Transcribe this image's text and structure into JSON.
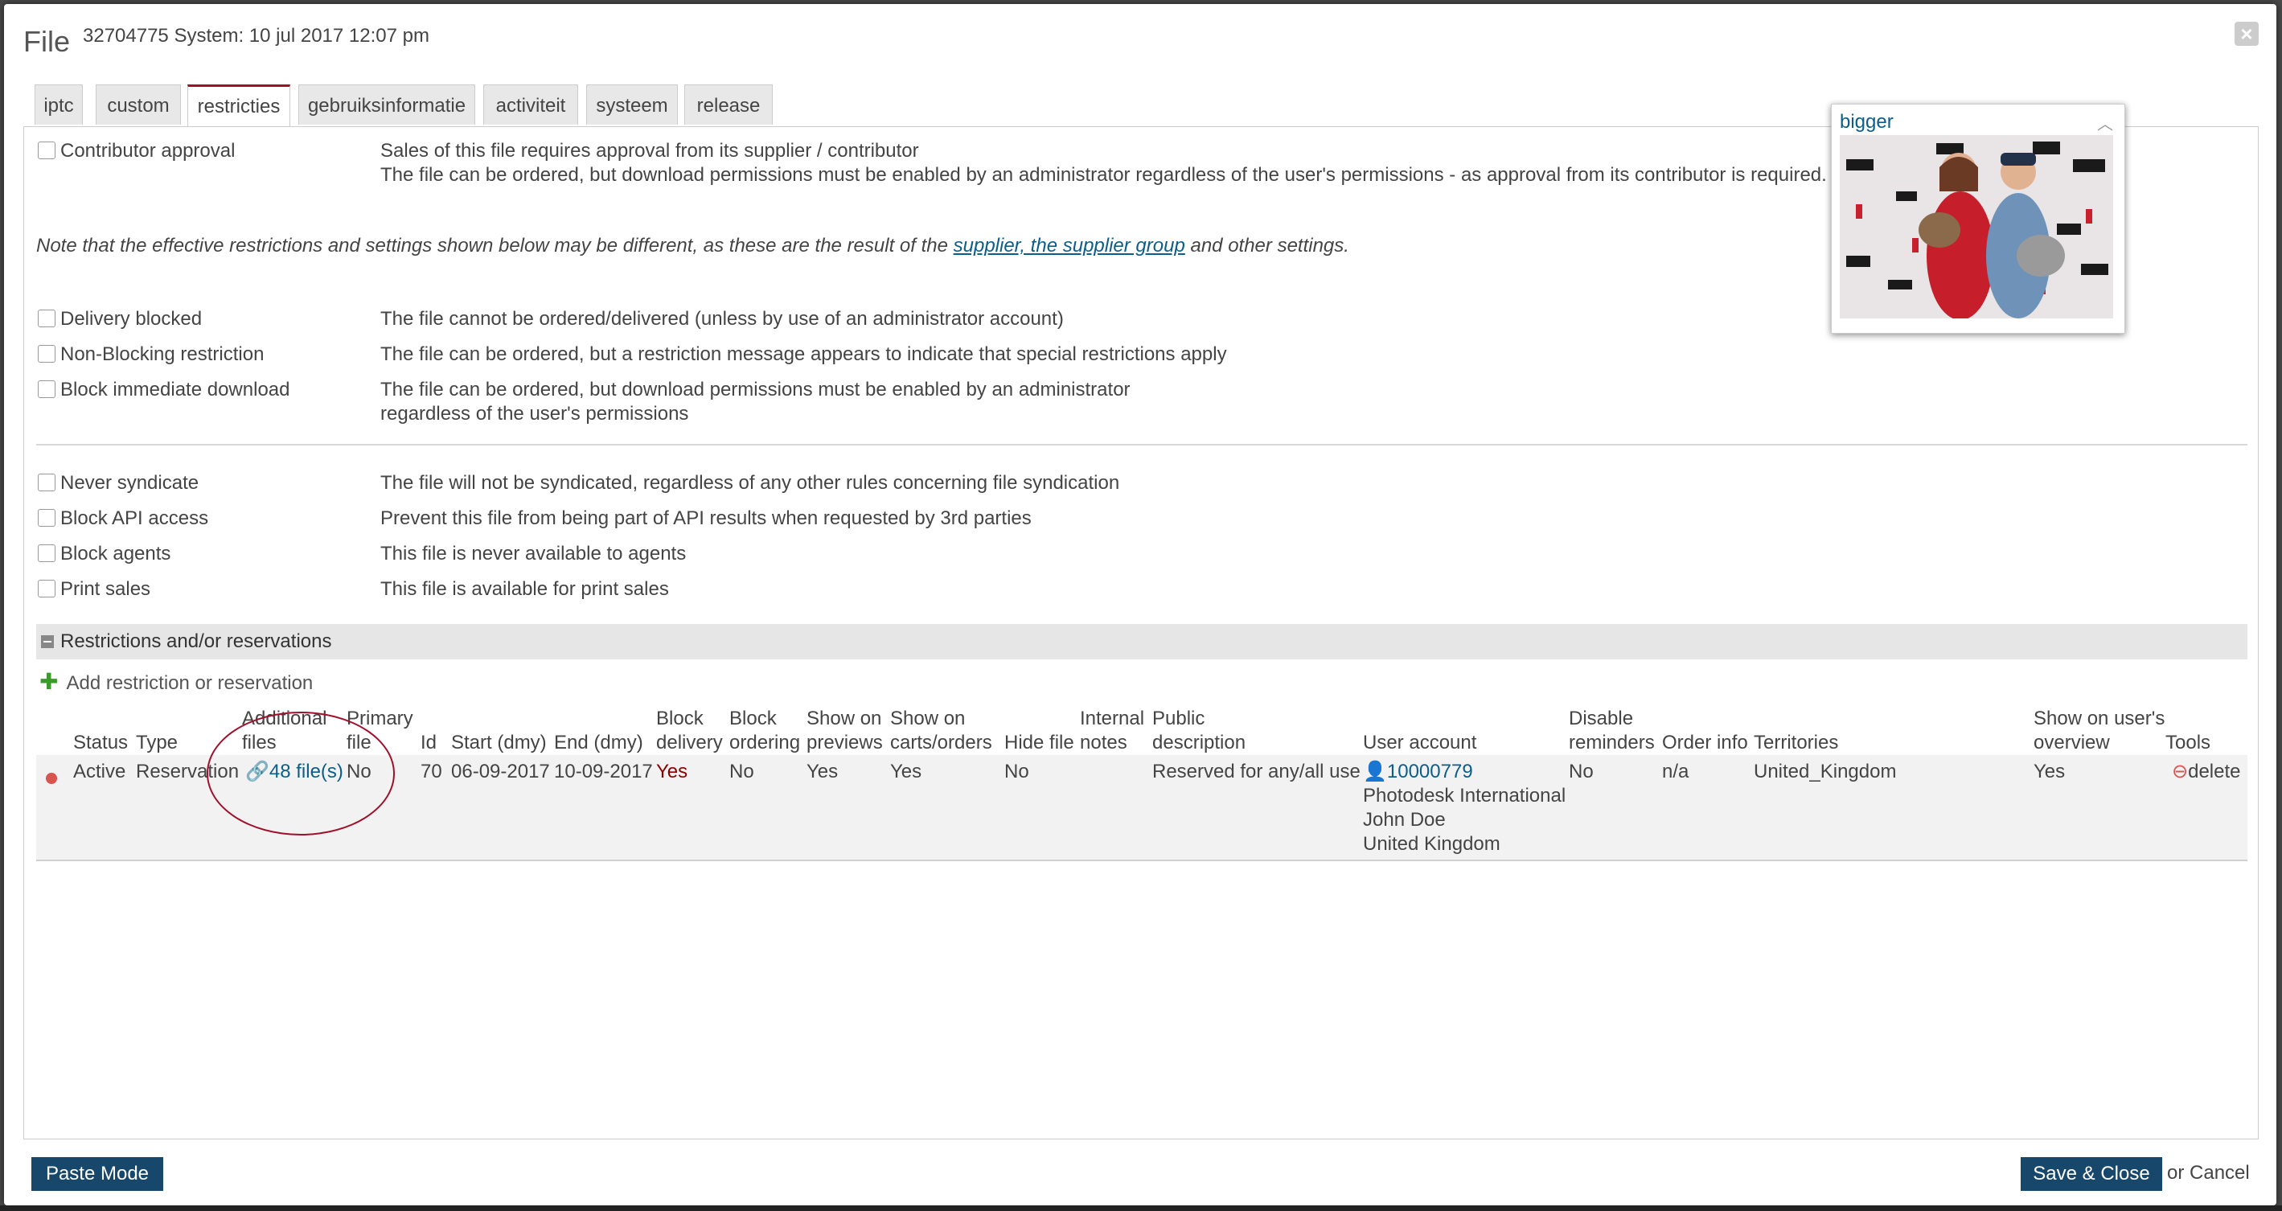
{
  "header": {
    "title": "File",
    "subtitle": "32704775 System: 10 jul 2017 12:07 pm",
    "close_label": "×"
  },
  "tabs": [
    {
      "label": "iptc"
    },
    {
      "label": "custom"
    },
    {
      "label": "restricties"
    },
    {
      "label": "gebruiksinformatie"
    },
    {
      "label": "activiteit"
    },
    {
      "label": "systeem"
    },
    {
      "label": "release"
    }
  ],
  "contributor": {
    "label": "Contributor approval",
    "desc1": "Sales of this file requires approval from its supplier / contributor",
    "desc2": "The file can be ordered, but download permissions must be enabled by an administrator regardless of the user's permissions - as approval from its contributor is required."
  },
  "note": {
    "pre": "Note that the effective restrictions and settings shown below may be different, as these are the result of the ",
    "link": "supplier, the supplier group",
    "post": " and other settings."
  },
  "restrictions": [
    {
      "label": "Delivery blocked",
      "desc": "The file cannot be ordered/delivered (unless by use of an administrator account)"
    },
    {
      "label": "Non-Blocking restriction",
      "desc": "The file can be ordered, but a restriction message appears to indicate that special restrictions apply"
    },
    {
      "label": "Block immediate download",
      "desc": "The file can be ordered, but download permissions must be enabled by an administrator",
      "desc2": "regardless of the user's permissions"
    }
  ],
  "syndication": [
    {
      "label": "Never syndicate",
      "desc": "The file will not be syndicated, regardless of any other rules concerning file syndication"
    },
    {
      "label": "Block API access",
      "desc": "Prevent this file from being part of API results when requested by 3rd parties"
    },
    {
      "label": "Block agents",
      "desc": "This file is never available to agents"
    },
    {
      "label": "Print sales",
      "desc": "This file is available for print sales"
    }
  ],
  "section": {
    "title": "Restrictions and/or reservations",
    "add_label": "Add restriction or reservation"
  },
  "table": {
    "headers": {
      "status": "Status",
      "type": "Type",
      "additional_1": "Additional",
      "additional_2": "files",
      "primary_1": "Primary",
      "primary_2": "file",
      "id": "Id",
      "start": "Start (dmy)",
      "end": "End (dmy)",
      "block_delivery_1": "Block",
      "block_delivery_2": "delivery",
      "block_ordering_1": "Block",
      "block_ordering_2": "ordering",
      "show_previews_1": "Show on",
      "show_previews_2": "previews",
      "show_carts_1": "Show on",
      "show_carts_2": "carts/orders",
      "hide_file": "Hide file",
      "internal_1": "Internal",
      "internal_2": "notes",
      "public_1": "Public",
      "public_2": "description",
      "user_account": "User account",
      "disable_1": "Disable",
      "disable_2": "reminders",
      "order_info": "Order info",
      "territories": "Territories",
      "show_user_1": "Show on user's",
      "show_user_2": "overview",
      "tools": "Tools"
    },
    "row": {
      "status": "Active",
      "type": "Reservation",
      "additional": "48 file(s)",
      "primary": "No",
      "id": "70",
      "start": "06-09-2017",
      "end": "10-09-2017",
      "block_delivery": "Yes",
      "block_ordering": "No",
      "show_previews": "Yes",
      "show_carts": "Yes",
      "hide_file": "No",
      "public_description": "Reserved for any/all use",
      "user_id": "10000779",
      "user_company": "Photodesk International",
      "user_name": "John Doe",
      "user_country": "United Kingdom",
      "disable_reminders": "No",
      "order_info": "n/a",
      "territories": "United_Kingdom",
      "show_user_overview": "Yes",
      "tool_delete": "delete"
    }
  },
  "preview": {
    "label": "bigger"
  },
  "footer": {
    "paste_mode": "Paste Mode",
    "save_close": "Save & Close",
    "or_cancel": "or Cancel"
  }
}
